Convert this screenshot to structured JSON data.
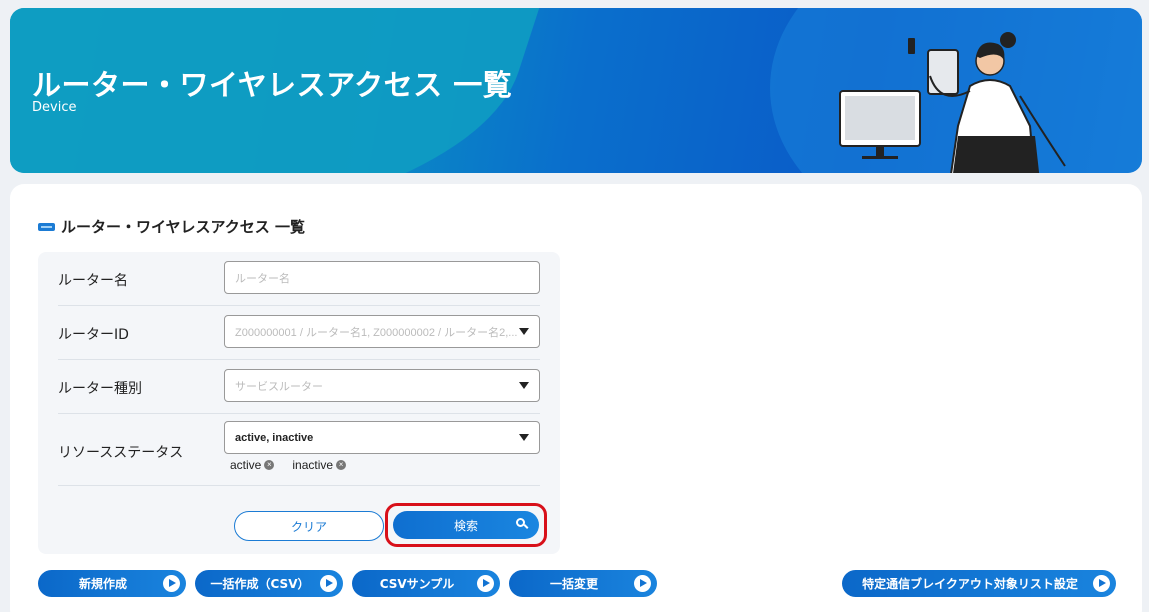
{
  "banner": {
    "title": "ルーター・ワイヤレスアクセス 一覧",
    "subtitle": "Device"
  },
  "section": {
    "title": "ルーター・ワイヤレスアクセス 一覧"
  },
  "form": {
    "router_name": {
      "label": "ルーター名",
      "placeholder": "ルーター名",
      "value": ""
    },
    "router_id": {
      "label": "ルーターID",
      "placeholder": "Z000000001 / ルーター名1, Z000000002 / ルーター名2,..."
    },
    "router_type": {
      "label": "ルーター種別",
      "placeholder": "サービスルーター"
    },
    "resource_status": {
      "label": "リソースステータス",
      "value": "active, inactive",
      "chips": [
        "active",
        "inactive"
      ]
    },
    "clear_label": "クリア",
    "search_label": "検索"
  },
  "actions": {
    "new_label": "新規作成",
    "bulk_create_label": "一括作成（CSV）",
    "csv_sample_label": "CSVサンプル",
    "bulk_change_label": "一括変更",
    "breakout_label": "特定通信ブレイクアウト対象リスト設定"
  },
  "colors": {
    "accent": "#1b7bd4",
    "highlight": "#d8101a"
  }
}
